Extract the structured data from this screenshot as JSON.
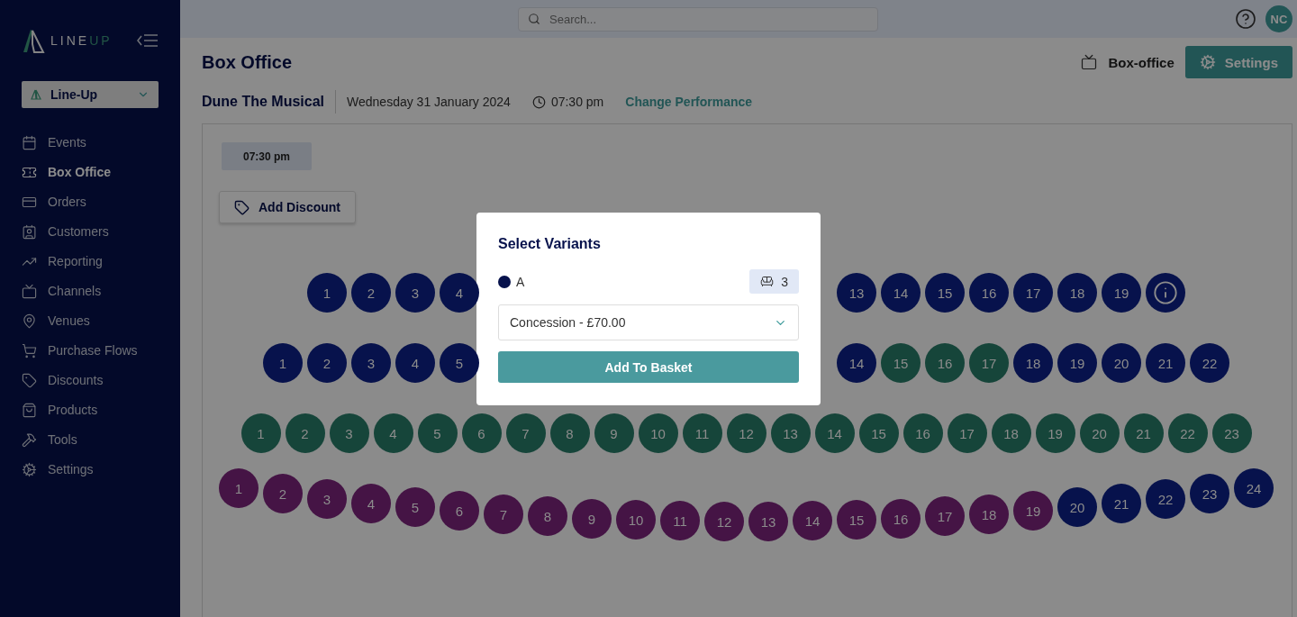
{
  "sidebar": {
    "logo": {
      "parts": [
        "LINE",
        "UP"
      ]
    },
    "org_select": {
      "value": "Line-Up"
    },
    "nav": [
      {
        "label": "Events",
        "selected": false
      },
      {
        "label": "Box Office",
        "selected": true
      },
      {
        "label": "Orders",
        "selected": false
      },
      {
        "label": "Customers",
        "selected": false
      },
      {
        "label": "Reporting",
        "selected": false
      },
      {
        "label": "Channels",
        "selected": false
      },
      {
        "label": "Venues",
        "selected": false
      },
      {
        "label": "Purchase Flows",
        "selected": false
      },
      {
        "label": "Discounts",
        "selected": false
      },
      {
        "label": "Products",
        "selected": false
      },
      {
        "label": "Tools",
        "selected": false
      },
      {
        "label": "Settings",
        "selected": false
      }
    ]
  },
  "topbar": {
    "search": {
      "placeholder": "Search..."
    },
    "avatar": "NC"
  },
  "header": {
    "title": "Box Office",
    "channel": "Box-office",
    "settings_button": "Settings"
  },
  "performance": {
    "event": "Dune The Musical",
    "date": "Wednesday 31 January 2024",
    "time": "07:30 pm",
    "change_link": "Change Performance"
  },
  "panel": {
    "time_chip": "07:30 pm",
    "discount_button": "Add Discount"
  },
  "seat_map": {
    "rows": [
      {
        "kind": "split",
        "left": [
          {
            "label": "1",
            "color": "#07124c"
          },
          {
            "label": "2",
            "color": "#07124c"
          },
          {
            "label": "3",
            "color": "#07124c"
          },
          {
            "label": "4",
            "color": "#07124c"
          }
        ],
        "right": [
          {
            "label": "13",
            "color": "#07124c"
          },
          {
            "label": "14",
            "color": "#07124c"
          },
          {
            "label": "15",
            "color": "#07124c"
          },
          {
            "label": "16",
            "color": "#07124c"
          },
          {
            "label": "17",
            "color": "#07124c"
          },
          {
            "label": "18",
            "color": "#07124c"
          },
          {
            "label": "19",
            "color": "#07124c"
          },
          {
            "kind": "info",
            "color": "#07124c"
          }
        ]
      },
      {
        "kind": "split",
        "left": [
          {
            "label": "1",
            "color": "#07124c"
          },
          {
            "label": "2",
            "color": "#07124c"
          },
          {
            "label": "3",
            "color": "#07124c"
          },
          {
            "label": "4",
            "color": "#07124c"
          },
          {
            "label": "5",
            "color": "#07124c"
          }
        ],
        "right": [
          {
            "label": "14",
            "color": "#07124c"
          },
          {
            "label": "15",
            "color": "#16453a"
          },
          {
            "label": "16",
            "color": "#16453a"
          },
          {
            "label": "17",
            "color": "#16453a"
          },
          {
            "label": "18",
            "color": "#07124c"
          },
          {
            "label": "19",
            "color": "#07124c"
          },
          {
            "label": "20",
            "color": "#07124c"
          },
          {
            "label": "21",
            "color": "#07124c"
          },
          {
            "label": "22",
            "color": "#07124c"
          }
        ]
      },
      {
        "kind": "straight",
        "left": [
          {
            "label": "1",
            "color": "#16453a"
          },
          {
            "label": "2",
            "color": "#16453a"
          },
          {
            "label": "3",
            "color": "#16453a"
          },
          {
            "label": "4",
            "color": "#16453a"
          },
          {
            "label": "5",
            "color": "#16453a"
          },
          {
            "label": "6",
            "color": "#16453a"
          },
          {
            "label": "7",
            "color": "#16453a"
          },
          {
            "label": "8",
            "color": "#16453a"
          },
          {
            "label": "9",
            "color": "#16453a"
          },
          {
            "label": "10",
            "color": "#16453a"
          },
          {
            "label": "11",
            "color": "#16453a"
          },
          {
            "label": "12",
            "color": "#16453a"
          },
          {
            "label": "13",
            "color": "#16453a"
          },
          {
            "label": "14",
            "color": "#16453a"
          },
          {
            "label": "15",
            "color": "#16453a"
          },
          {
            "label": "16",
            "color": "#16453a"
          },
          {
            "label": "17",
            "color": "#16453a"
          },
          {
            "label": "18",
            "color": "#16453a"
          },
          {
            "label": "19",
            "color": "#16453a"
          },
          {
            "label": "20",
            "color": "#16453a"
          },
          {
            "label": "21",
            "color": "#16453a"
          },
          {
            "label": "22",
            "color": "#16453a"
          },
          {
            "label": "23",
            "color": "#16453a"
          }
        ]
      },
      {
        "kind": "curve",
        "left": [
          {
            "label": "1",
            "color": "#451445"
          },
          {
            "label": "2",
            "color": "#451445"
          },
          {
            "label": "3",
            "color": "#451445"
          },
          {
            "label": "4",
            "color": "#451445"
          },
          {
            "label": "5",
            "color": "#451445"
          },
          {
            "label": "6",
            "color": "#451445"
          },
          {
            "label": "7",
            "color": "#451445"
          },
          {
            "label": "8",
            "color": "#451445"
          },
          {
            "label": "9",
            "color": "#451445"
          },
          {
            "label": "10",
            "color": "#451445"
          },
          {
            "label": "11",
            "color": "#451445"
          },
          {
            "label": "12",
            "color": "#451445"
          },
          {
            "label": "13",
            "color": "#451445"
          },
          {
            "label": "14",
            "color": "#451445"
          },
          {
            "label": "15",
            "color": "#451445"
          },
          {
            "label": "16",
            "color": "#451445"
          },
          {
            "label": "17",
            "color": "#451445"
          },
          {
            "label": "18",
            "color": "#451445"
          },
          {
            "label": "19",
            "color": "#451445"
          },
          {
            "label": "20",
            "color": "#07124c"
          },
          {
            "label": "21",
            "color": "#07124c"
          },
          {
            "label": "22",
            "color": "#07124c"
          },
          {
            "label": "23",
            "color": "#07124c"
          },
          {
            "label": "24",
            "color": "#07124c"
          }
        ]
      }
    ]
  },
  "modal": {
    "title": "Select Variants",
    "variant": {
      "label": "A",
      "color": "#07124c",
      "count": "3"
    },
    "select": {
      "value": "Concession - £70.00"
    },
    "submit": "Add To Basket"
  }
}
